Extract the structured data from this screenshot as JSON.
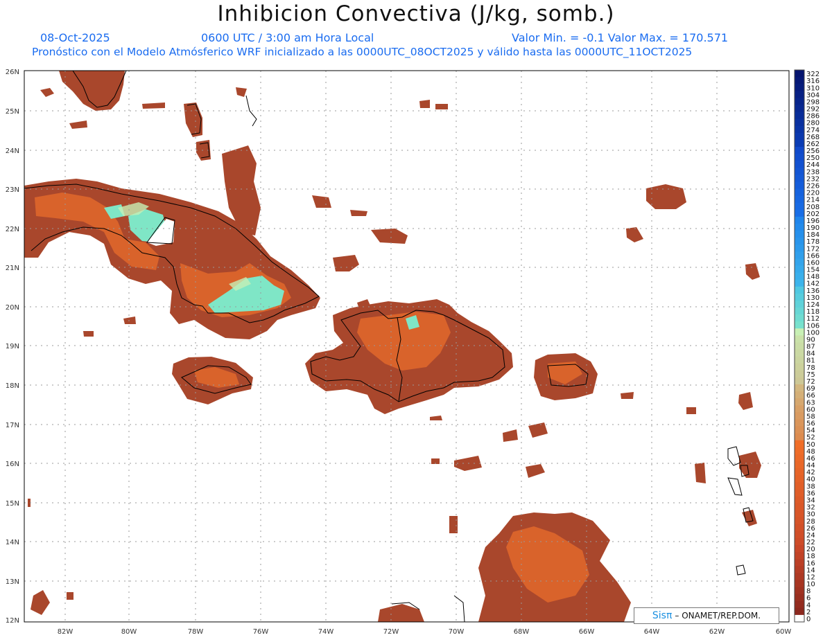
{
  "header": {
    "title": "Inhibicion Convectiva (J/kg, somb.)",
    "date": "08-Oct-2025",
    "time": "0600 UTC / 3:00 am Hora Local",
    "value_range": "Valor Min. = -0.1  Valor Max. = 170.571",
    "model_info": "Pronóstico con el Modelo Atmósferico WRF inicializado a las 0000UTC_08OCT2025 y válido hasta las  0000UTC_11OCT2025"
  },
  "map": {
    "lat_labels": [
      "26N",
      "25N",
      "24N",
      "23N",
      "22N",
      "21N",
      "20N",
      "19N",
      "18N",
      "17N",
      "16N",
      "15N",
      "14N",
      "13N",
      "12N"
    ],
    "lon_labels": [
      "82W",
      "80W",
      "78W",
      "76W",
      "74W",
      "72W",
      "70W",
      "68W",
      "66W",
      "64W",
      "62W",
      "60W"
    ],
    "colors": {
      "land_cin": "#a9472c",
      "mid_cin": "#e2692c",
      "high_cin": "#7fe6c6",
      "coast": "#000000",
      "grid": "#9a9a9a"
    }
  },
  "legend": {
    "labels": [
      "322",
      "316",
      "310",
      "304",
      "298",
      "292",
      "286",
      "280",
      "274",
      "268",
      "262",
      "256",
      "250",
      "244",
      "238",
      "232",
      "226",
      "220",
      "214",
      "208",
      "202",
      "196",
      "190",
      "184",
      "178",
      "172",
      "166",
      "160",
      "154",
      "148",
      "142",
      "136",
      "130",
      "124",
      "118",
      "112",
      "106",
      "100",
      "90",
      "87",
      "84",
      "81",
      "78",
      "75",
      "72",
      "69",
      "66",
      "63",
      "60",
      "58",
      "56",
      "54",
      "52",
      "50",
      "48",
      "46",
      "44",
      "42",
      "40",
      "38",
      "36",
      "34",
      "32",
      "30",
      "28",
      "26",
      "24",
      "22",
      "20",
      "18",
      "16",
      "14",
      "12",
      "10",
      "8",
      "6",
      "4",
      "2",
      "0"
    ]
  },
  "credit": {
    "brand": "Sisπ",
    "text": "– ONAMET/REP.DOM."
  }
}
